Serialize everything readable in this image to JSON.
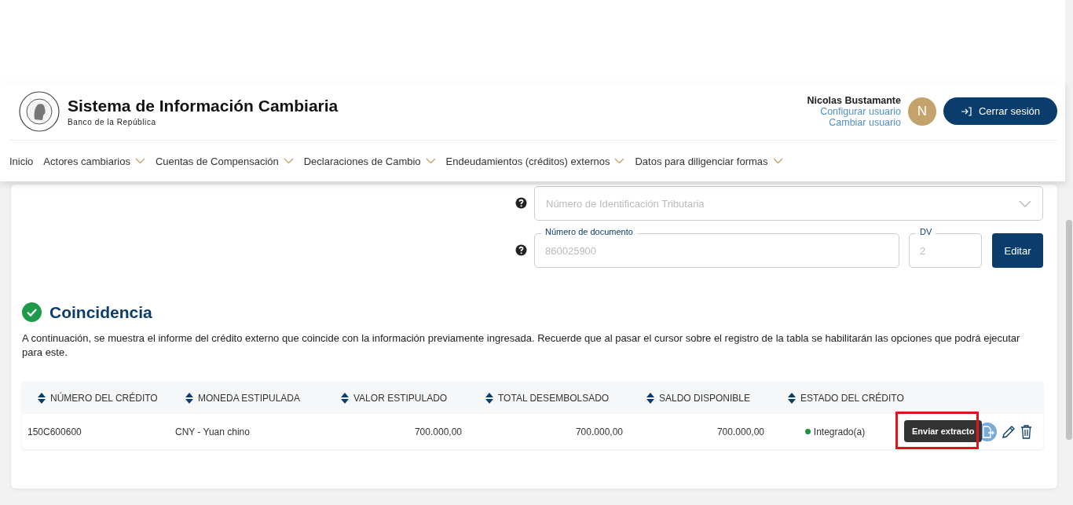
{
  "header": {
    "title": "Sistema de Información Cambiaria",
    "subtitle": "Banco de la República",
    "user_name": "Nicolas Bustamante",
    "user_links": [
      "Configurar usuario",
      "Cambiar usuario"
    ],
    "avatar_initial": "N",
    "logout_button": "Cerrar sesión"
  },
  "nav": [
    {
      "label": "Inicio",
      "dropdown": false
    },
    {
      "label": "Actores cambiarios",
      "dropdown": true
    },
    {
      "label": "Cuentas de Compensación",
      "dropdown": true
    },
    {
      "label": "Declaraciones de Cambio",
      "dropdown": true
    },
    {
      "label": "Endeudamientos (créditos) externos",
      "dropdown": true
    },
    {
      "label": "Datos para diligenciar formas",
      "dropdown": true
    }
  ],
  "form": {
    "tax_id_select": {
      "placeholder": "Número de Identificación Tributaria"
    },
    "document_field": {
      "label": "Número de documento",
      "value": "860025900"
    },
    "dv_field": {
      "label": "DV",
      "value": "2"
    },
    "edit_button": "Editar"
  },
  "result": {
    "title": "Coincidencia",
    "description": "A continuación, se muestra el informe del crédito externo que coincide con la información previamente ingresada. Recuerde que al pasar el cursor sobre el registro de la tabla se habilitarán las opciones que podrá ejecutar para este.",
    "table": {
      "columns": [
        "NÚMERO DEL CRÉDITO",
        "MONEDA ESTIPULADA",
        "VALOR ESTIPULADO",
        "TOTAL DESEMBOLSADO",
        "SALDO DISPONIBLE",
        "ESTADO DEL CRÉDITO"
      ],
      "rows": [
        {
          "cells": [
            "150C600600",
            "CNY - Yuan chino",
            "700.000,00",
            "700.000,00",
            "700.000,00"
          ],
          "status": {
            "label": "Integrado(a)",
            "color": "#1a9641"
          },
          "tooltip": "Enviar extracto",
          "highlighted": true
        }
      ]
    }
  }
}
